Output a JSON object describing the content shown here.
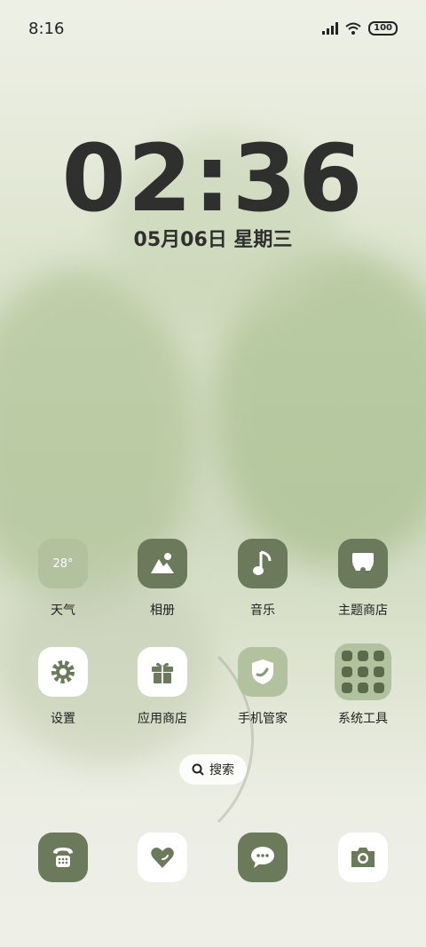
{
  "status_bar": {
    "time": "8:16",
    "battery": "100"
  },
  "lockscreen": {
    "time": "02:36",
    "date": "05月06日 星期三"
  },
  "apps": {
    "weather": {
      "label": "天气",
      "temp": "28°"
    },
    "gallery": {
      "label": "相册"
    },
    "music": {
      "label": "音乐"
    },
    "themes": {
      "label": "主题商店"
    },
    "settings": {
      "label": "设置"
    },
    "app_store": {
      "label": "应用商店"
    },
    "phone_manager": {
      "label": "手机管家"
    },
    "system_tools": {
      "label": "系统工具"
    }
  },
  "search": {
    "label": "搜索"
  },
  "dock": [
    "phone",
    "health",
    "messages",
    "camera"
  ],
  "colors": {
    "dark_icon": "#6b7a5a",
    "pale_icon": "#b2c19e",
    "text": "#222222"
  }
}
